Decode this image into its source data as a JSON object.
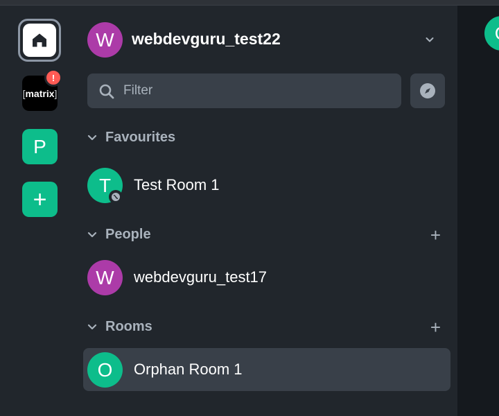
{
  "spaces": {
    "home_label": "Home",
    "matrix_label": "matrix",
    "matrix_badge": "!",
    "p_letter": "P",
    "add_symbol": "+"
  },
  "user": {
    "initial": "W",
    "name": "webdevguru_test22",
    "avatar_color": "#ac3ba8"
  },
  "search": {
    "placeholder": "Filter"
  },
  "sections": {
    "favourites": {
      "label": "Favourites",
      "rooms": [
        {
          "initial": "T",
          "name": "Test Room 1",
          "avatar_color": "#0dbd8b"
        }
      ]
    },
    "people": {
      "label": "People",
      "add": "+",
      "rooms": [
        {
          "initial": "W",
          "name": "webdevguru_test17",
          "avatar_color": "#ac3ba8"
        }
      ]
    },
    "rooms": {
      "label": "Rooms",
      "add": "+",
      "rooms": [
        {
          "initial": "O",
          "name": "Orphan Room 1",
          "avatar_color": "#0dbd8b"
        }
      ]
    }
  },
  "right_pane": {
    "avatar_initial": "O"
  },
  "colors": {
    "accent": "#0dbd8b",
    "badge": "#ff5b55",
    "panel": "#21262c",
    "selected": "#394049"
  },
  "icons": [
    "home-icon",
    "search-icon",
    "explore-icon",
    "chevron-down-icon",
    "public-room-icon",
    "plus-icon"
  ]
}
